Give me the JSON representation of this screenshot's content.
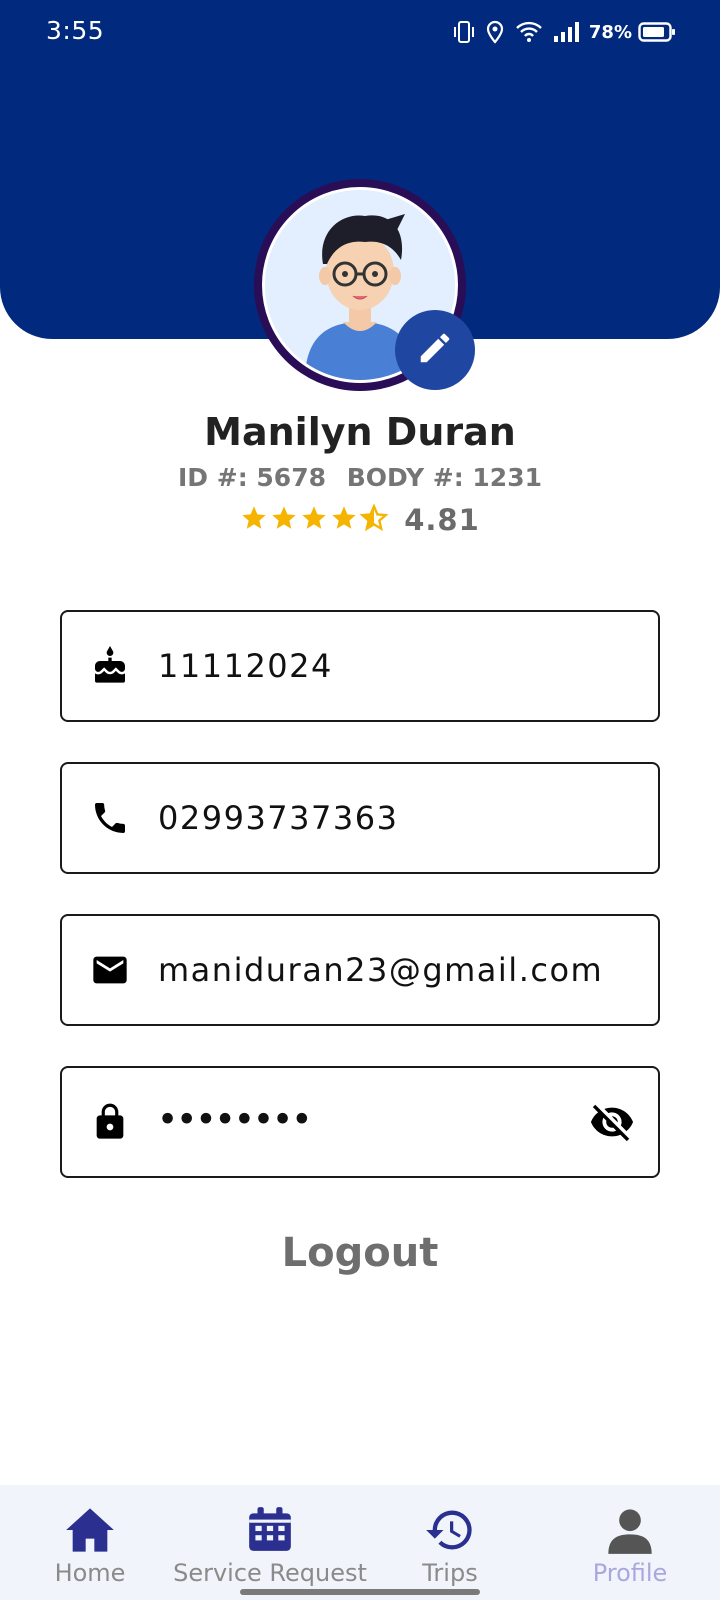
{
  "status_bar": {
    "time": "3:55",
    "battery_percent": "78%",
    "icons": [
      "vibrate-icon",
      "location-icon",
      "wifi-icon",
      "signal-icon",
      "battery-icon"
    ]
  },
  "profile": {
    "name": "Manilyn Duran",
    "id_text": "ID #: 5678",
    "body_text": "BODY #: 1231",
    "rating": 4.81,
    "rating_text": "4.81",
    "stars_full": 4,
    "stars_half": 1
  },
  "fields": {
    "birthday": {
      "value": "11112024",
      "icon": "cake-icon"
    },
    "phone": {
      "value": "02993737363",
      "icon": "phone-icon"
    },
    "email": {
      "value": "maniduran23@gmail.com",
      "icon": "mail-icon"
    },
    "password": {
      "value": "••••••••",
      "icon": "lock-icon",
      "toggle_icon": "visibility-off-icon"
    }
  },
  "logout_label": "Logout",
  "bottom_nav": {
    "items": [
      {
        "label": "Home",
        "icon": "home-icon"
      },
      {
        "label": "Service Request",
        "icon": "calendar-icon"
      },
      {
        "label": "Trips",
        "icon": "history-icon"
      },
      {
        "label": "Profile",
        "icon": "person-icon",
        "active": true
      }
    ]
  },
  "colors": {
    "header": "#012a7e",
    "edit_button": "#1f47a1",
    "star": "#f5b400",
    "nav_icon": "#2b2f8f",
    "nav_active_label": "#a9a7e0"
  }
}
